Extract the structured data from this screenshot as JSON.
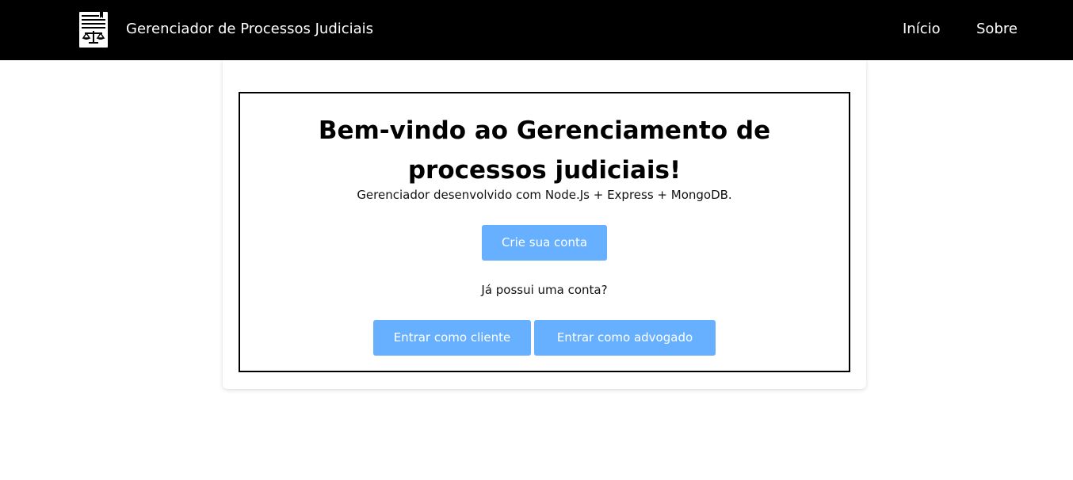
{
  "header": {
    "title": "Gerenciador de Processos Judiciais",
    "logo_icon": "legal-document-scales-icon",
    "nav": {
      "home_label": "Início",
      "about_label": "Sobre"
    }
  },
  "main": {
    "heading_line1": "Bem-vindo ao Gerenciamento de",
    "heading_line2": "processos judiciais!",
    "subtitle": "Gerenciador desenvolvido com Node.Js + Express + MongoDB.",
    "create_account_label": "Crie sua conta",
    "account_question": "Já possui uma conta?",
    "login_client_label": "Entrar como cliente",
    "login_lawyer_label": "Entrar como advogado"
  },
  "colors": {
    "navbar_bg": "#000000",
    "button_bg": "#66b0ff",
    "button_text": "#ffffff"
  }
}
